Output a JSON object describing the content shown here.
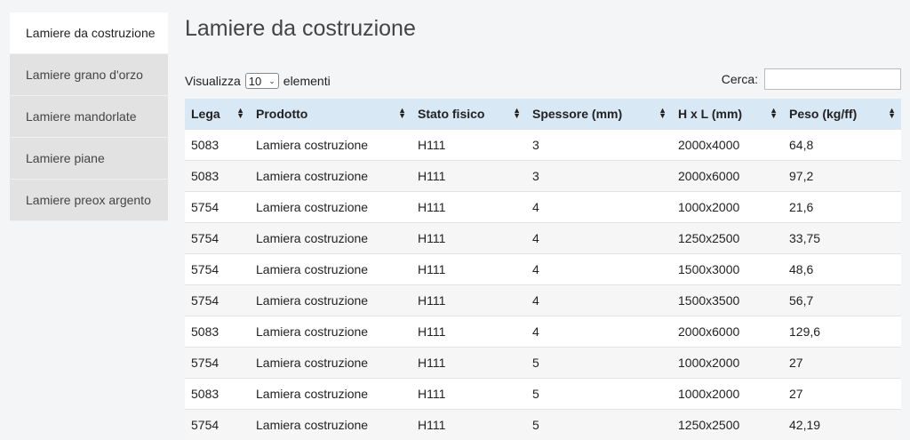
{
  "sidebar": {
    "items": [
      {
        "label": "Lamiere da costruzione",
        "active": true
      },
      {
        "label": "Lamiere grano d'orzo",
        "active": false
      },
      {
        "label": "Lamiere mandorlate",
        "active": false
      },
      {
        "label": "Lamiere piane",
        "active": false
      },
      {
        "label": "Lamiere preox argento",
        "active": false
      }
    ]
  },
  "main": {
    "title": "Lamiere da costruzione",
    "length": {
      "prefix": "Visualizza",
      "value": "10",
      "suffix": "elementi"
    },
    "search": {
      "label": "Cerca:",
      "value": ""
    },
    "table": {
      "headers": [
        "Lega",
        "Prodotto",
        "Stato fisico",
        "Spessore (mm)",
        "H x L (mm)",
        "Peso (kg/ff)"
      ],
      "rows": [
        [
          "5083",
          "Lamiera costruzione",
          "H111",
          "3",
          "2000x4000",
          "64,8"
        ],
        [
          "5083",
          "Lamiera costruzione",
          "H111",
          "3",
          "2000x6000",
          "97,2"
        ],
        [
          "5754",
          "Lamiera costruzione",
          "H111",
          "4",
          "1000x2000",
          "21,6"
        ],
        [
          "5754",
          "Lamiera costruzione",
          "H111",
          "4",
          "1250x2500",
          "33,75"
        ],
        [
          "5754",
          "Lamiera costruzione",
          "H111",
          "4",
          "1500x3000",
          "48,6"
        ],
        [
          "5754",
          "Lamiera costruzione",
          "H111",
          "4",
          "1500x3500",
          "56,7"
        ],
        [
          "5083",
          "Lamiera costruzione",
          "H111",
          "4",
          "2000x6000",
          "129,6"
        ],
        [
          "5754",
          "Lamiera costruzione",
          "H111",
          "5",
          "1000x2000",
          "27"
        ],
        [
          "5083",
          "Lamiera costruzione",
          "H111",
          "5",
          "1000x2000",
          "27"
        ],
        [
          "5754",
          "Lamiera costruzione",
          "H111",
          "5",
          "1250x2500",
          "42,19"
        ]
      ]
    }
  }
}
